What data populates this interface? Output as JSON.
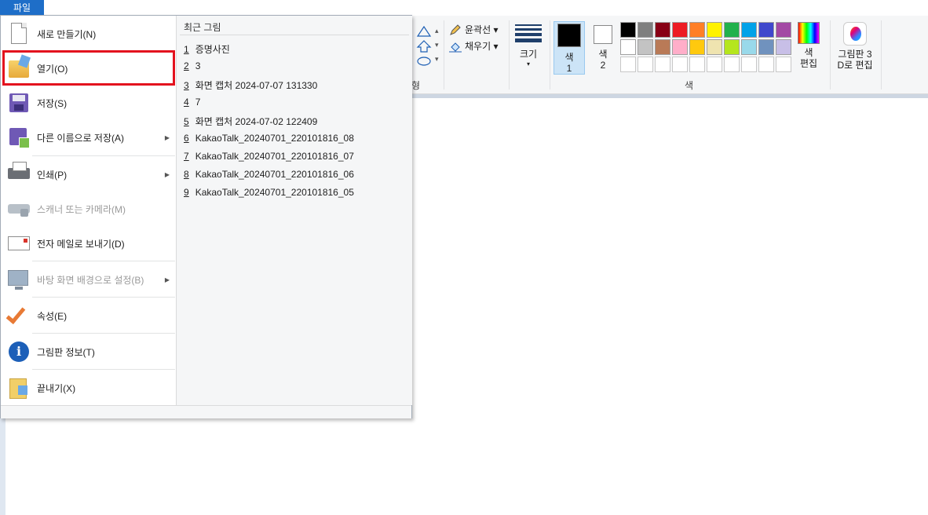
{
  "ribbon": {
    "file_tab": "파일",
    "group_shape_partial": "형",
    "outline_label": "윤곽선 ▾",
    "fill_label": "채우기 ▾",
    "size_label": "크기",
    "size_arrow": "▾",
    "color1_label_line1": "색",
    "color1_label_line2": "1",
    "color2_label_line1": "색",
    "color2_label_line2": "2",
    "colors_group_label": "색",
    "edit_colors_line1": "색",
    "edit_colors_line2": "편집",
    "paint3d_line1": "그림판 3",
    "paint3d_line2": "D로 편집",
    "palette_row1": [
      "#000000",
      "#7f7f7f",
      "#880015",
      "#ed1c24",
      "#ff7f27",
      "#fff200",
      "#22b14c",
      "#00a2e8",
      "#3f48cc",
      "#a349a4"
    ],
    "palette_row2": [
      "#ffffff",
      "#c3c3c3",
      "#b97a57",
      "#ffaec9",
      "#ffc90e",
      "#efe4b0",
      "#b5e61d",
      "#99d9ea",
      "#7092be",
      "#c8bfe7"
    ],
    "color1": "#000000",
    "color2": "#ffffff"
  },
  "menu": {
    "items": [
      {
        "label": "새로 만들기(N)",
        "icon": "new-document-icon"
      },
      {
        "label": "열기(O)",
        "icon": "open-folder-icon"
      },
      {
        "label": "저장(S)",
        "icon": "save-floppy-icon"
      },
      {
        "label": "다른 이름으로 저장(A)",
        "icon": "save-as-icon",
        "submenu_arrow": "▶"
      },
      {
        "label": "인쇄(P)",
        "icon": "printer-icon",
        "submenu_arrow": "▶"
      },
      {
        "label": "스캐너 또는 카메라(M)",
        "icon": "scanner-icon",
        "disabled": true
      },
      {
        "label": "전자 메일로 보내기(D)",
        "icon": "email-icon"
      },
      {
        "label": "바탕 화면 배경으로 설정(B)",
        "icon": "desktop-background-icon",
        "disabled": true,
        "submenu_arrow": "▶"
      },
      {
        "label": "속성(E)",
        "icon": "properties-check-icon"
      },
      {
        "label": "그림판 정보(T)",
        "icon": "info-icon"
      },
      {
        "label": "끝내기(X)",
        "icon": "exit-icon"
      }
    ],
    "recent_title": "최근 그림",
    "recent": [
      {
        "num": "1",
        "name": "증명사진"
      },
      {
        "num": "2",
        "name": "3"
      },
      {
        "num": "3",
        "name": "화면 캡처 2024-07-07 131330"
      },
      {
        "num": "4",
        "name": "7"
      },
      {
        "num": "5",
        "name": "화면 캡처 2024-07-02 122409"
      },
      {
        "num": "6",
        "name": "KakaoTalk_20240701_220101816_08"
      },
      {
        "num": "7",
        "name": "KakaoTalk_20240701_220101816_07"
      },
      {
        "num": "8",
        "name": "KakaoTalk_20240701_220101816_06"
      },
      {
        "num": "9",
        "name": "KakaoTalk_20240701_220101816_05"
      }
    ]
  }
}
